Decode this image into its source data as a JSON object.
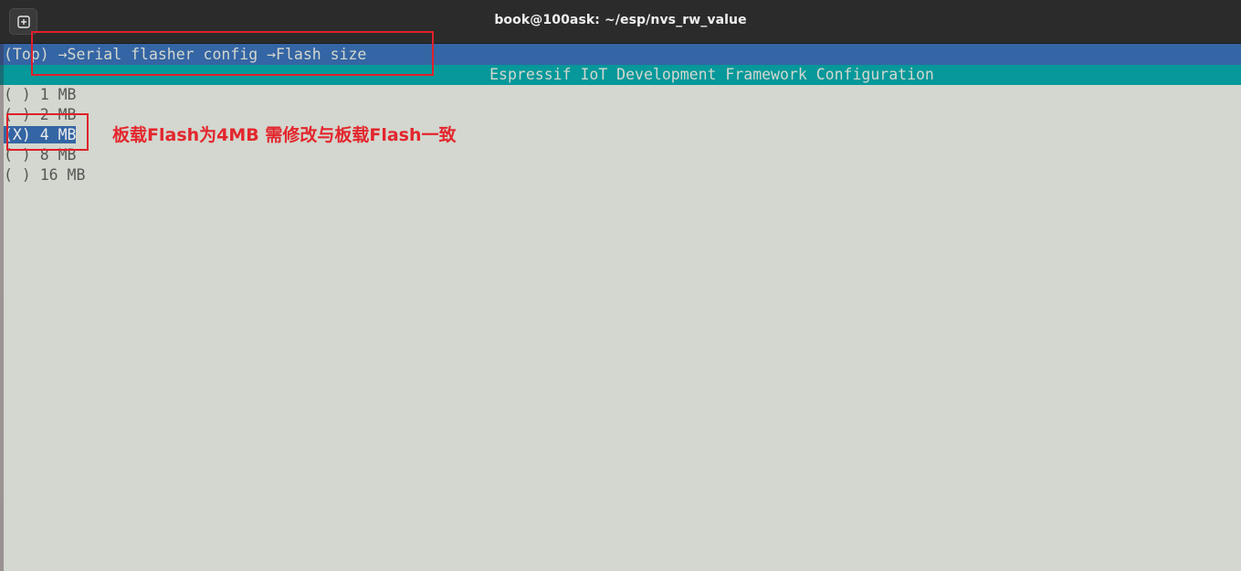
{
  "window": {
    "title": "book@100ask: ~/esp/nvs_rw_value",
    "new_tab_icon": "plus-in-box-icon"
  },
  "terminal": {
    "breadcrumb": "(Top) →Serial flasher config →Flash size",
    "header": "Espressif IoT Development Framework Configuration",
    "options": [
      {
        "label": "( ) 1 MB",
        "selected": false
      },
      {
        "label": "( ) 2 MB",
        "selected": false
      },
      {
        "label": "(X) 4 MB",
        "selected": true
      },
      {
        "label": "( ) 8 MB",
        "selected": false
      },
      {
        "label": "( ) 16 MB",
        "selected": false
      }
    ]
  },
  "annotation": {
    "text": "板载Flash为4MB 需修改与板载Flash一致",
    "color": "#e3262d"
  },
  "colors": {
    "breadcrumb_bg": "#3465a4",
    "header_bg": "#06989a",
    "terminal_bg": "#d3d7cf",
    "titlebar_bg": "#2b2b2b"
  }
}
